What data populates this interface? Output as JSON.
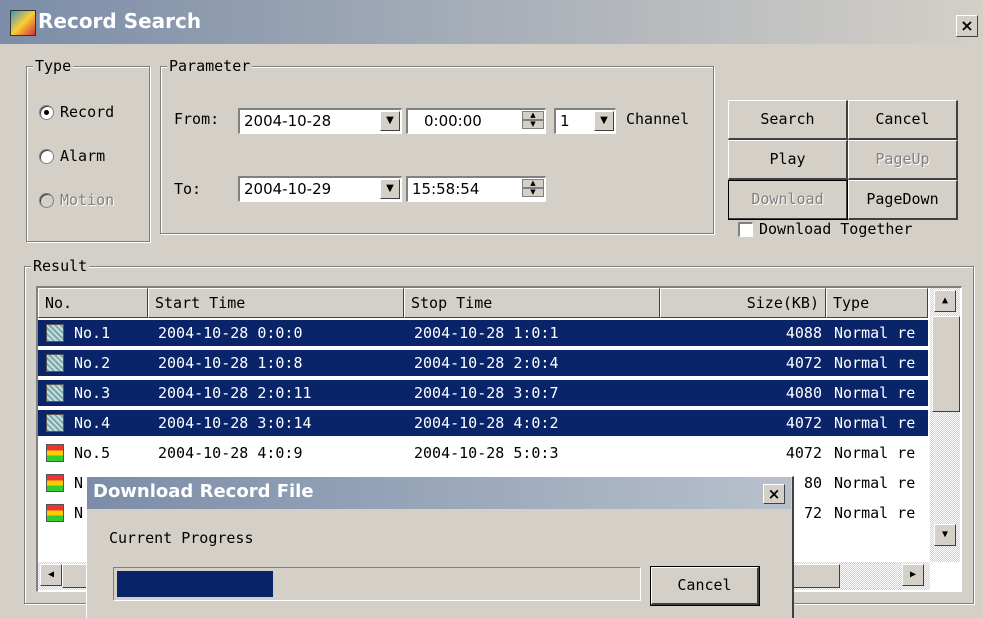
{
  "window": {
    "title": "Record Search",
    "close": "×"
  },
  "type_group": {
    "legend": "Type",
    "options": [
      {
        "label": "Record",
        "selected": true,
        "enabled": true
      },
      {
        "label": "Alarm",
        "selected": false,
        "enabled": true
      },
      {
        "label": "Motion",
        "selected": false,
        "enabled": false
      }
    ]
  },
  "parameter": {
    "legend": "Parameter",
    "from_label": "From:",
    "to_label": "To:",
    "from_date": "2004-10-28",
    "from_time": "0:00:00",
    "to_date": "2004-10-29",
    "to_time": "15:58:54",
    "channel_value": "1",
    "channel_label": "Channel"
  },
  "buttons": {
    "search": "Search",
    "cancel": "Cancel",
    "play": "Play",
    "pageup": "PageUp",
    "download": "Download",
    "pagedown": "PageDown",
    "download_together": "Download Together"
  },
  "result": {
    "legend": "Result",
    "columns": [
      "No.",
      "Start Time",
      "Stop Time",
      "Size(KB)",
      "Type"
    ],
    "rows": [
      {
        "no": "No.1",
        "start": "2004-10-28 0:0:0",
        "stop": "2004-10-28 1:0:1",
        "size": "4088",
        "type": "Normal re",
        "selected": true
      },
      {
        "no": "No.2",
        "start": "2004-10-28 1:0:8",
        "stop": "2004-10-28 2:0:4",
        "size": "4072",
        "type": "Normal re",
        "selected": true
      },
      {
        "no": "No.3",
        "start": "2004-10-28 2:0:11",
        "stop": "2004-10-28 3:0:7",
        "size": "4080",
        "type": "Normal re",
        "selected": true
      },
      {
        "no": "No.4",
        "start": "2004-10-28 3:0:14",
        "stop": "2004-10-28 4:0:2",
        "size": "4072",
        "type": "Normal re",
        "selected": true
      },
      {
        "no": "No.5",
        "start": "2004-10-28 4:0:9",
        "stop": "2004-10-28 5:0:3",
        "size": "4072",
        "type": "Normal re",
        "selected": false
      },
      {
        "no": "N",
        "start": "",
        "stop": "",
        "size": "80",
        "type": "Normal re",
        "selected": false
      },
      {
        "no": "N",
        "start": "",
        "stop": "",
        "size": "72",
        "type": "Normal re",
        "selected": false
      }
    ]
  },
  "download_dialog": {
    "title": "Download Record File",
    "close": "×",
    "progress_label": "Current Progress",
    "progress": 0.3,
    "cancel": "Cancel"
  }
}
